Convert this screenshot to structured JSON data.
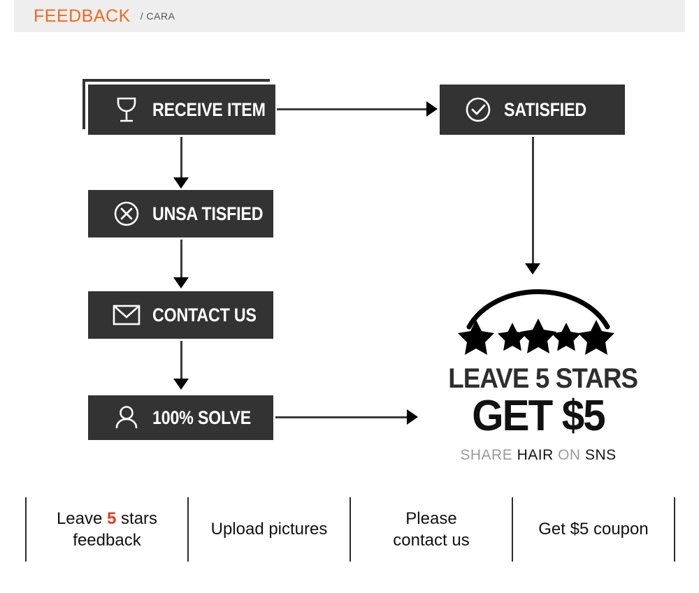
{
  "header": {
    "title": "FEEDBACK",
    "subtitle": "/ CARA",
    "accent_color": "#ee6a1e",
    "background_color": "#eeeeee"
  },
  "flow": {
    "box_color": "#333333",
    "text_color": "#ffffff",
    "steps": [
      {
        "id": "receive-item",
        "label": "RECEIVE ITEM",
        "icon": "wine-glass-icon",
        "stacked": true
      },
      {
        "id": "satisfied",
        "label": "SATISFIED",
        "icon": "check-circle-icon",
        "stacked": false
      },
      {
        "id": "unsatisfied",
        "label": "UNSA TISFIED",
        "icon": "x-circle-icon",
        "stacked": false
      },
      {
        "id": "contact-us",
        "label": "CONTACT US",
        "icon": "envelope-icon",
        "stacked": false
      },
      {
        "id": "solve",
        "label": "100% SOLVE",
        "icon": "person-icon",
        "stacked": false
      }
    ],
    "arrows": [
      {
        "id": "receive-to-satisfied",
        "direction": "right"
      },
      {
        "id": "receive-to-unsatisfied",
        "direction": "down"
      },
      {
        "id": "unsatisfied-to-contact",
        "direction": "down"
      },
      {
        "id": "contact-to-solve",
        "direction": "down"
      },
      {
        "id": "satisfied-to-promo",
        "direction": "down"
      },
      {
        "id": "solve-to-promo",
        "direction": "right"
      }
    ]
  },
  "promo": {
    "stars_count": 5,
    "line1": "LEAVE 5 STARS",
    "line2": "GET $5",
    "line3_parts": [
      {
        "text": "SHARE",
        "tone": "dim"
      },
      {
        "text": "HAIR",
        "tone": "dark"
      },
      {
        "text": "ON",
        "tone": "dim"
      },
      {
        "text": "SNS",
        "tone": "dark"
      }
    ]
  },
  "footer": {
    "cells": [
      {
        "id": "leave-5-stars-feedback",
        "prefix": "Leave ",
        "accent": "5",
        "suffix": " stars",
        "line2": "feedback"
      },
      {
        "id": "upload-pictures",
        "prefix": "Upload pictures",
        "accent": "",
        "suffix": "",
        "line2": ""
      },
      {
        "id": "please-contact-us",
        "prefix": "Please",
        "accent": "",
        "suffix": "",
        "line2": "contact us"
      },
      {
        "id": "get-5-coupon",
        "prefix": "Get $5 coupon",
        "accent": "",
        "suffix": "",
        "line2": ""
      }
    ],
    "accent_color": "#e03c20"
  }
}
